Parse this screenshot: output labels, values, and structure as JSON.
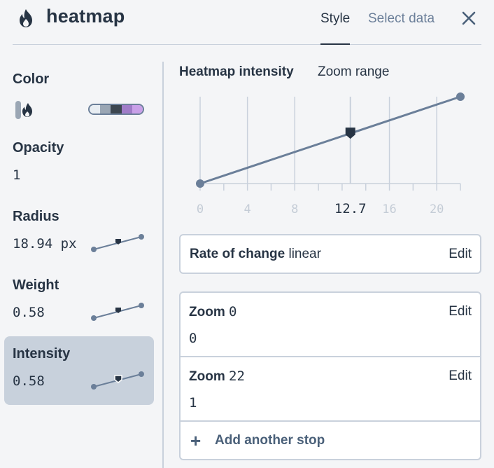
{
  "header": {
    "title": "heatmap",
    "tabs": [
      {
        "label": "Style",
        "active": true
      },
      {
        "label": "Select data",
        "active": false
      }
    ],
    "icons": {
      "app": "flame-icon",
      "close": "close-icon"
    }
  },
  "sidebar": {
    "color": {
      "label": "Color",
      "ramp": [
        "#dfe6ee",
        "#9aa6b4",
        "#4c5660",
        "#b58fd9",
        "#c9a0e8"
      ]
    },
    "opacity": {
      "label": "Opacity",
      "value": "1"
    },
    "radius": {
      "label": "Radius",
      "value": "18.94 px"
    },
    "weight": {
      "label": "Weight",
      "value": "0.58"
    },
    "intensity": {
      "label": "Intensity",
      "value": "0.58",
      "selected": true
    }
  },
  "panel": {
    "tab_active": "Heatmap intensity",
    "tab_other": "Zoom range",
    "chart_data": {
      "type": "line",
      "x_ticks": [
        "0",
        "4",
        "8",
        "12.7",
        "16",
        "20"
      ],
      "current_zoom": 12.7,
      "xlim": [
        0,
        22
      ],
      "ylim": [
        0,
        1
      ],
      "points": [
        {
          "x": 0,
          "y": 0
        },
        {
          "x": 22,
          "y": 1
        }
      ],
      "marker": {
        "x": 12.7,
        "y": 0.58
      }
    },
    "rate": {
      "label": "Rate of change",
      "value": "linear",
      "edit": "Edit"
    },
    "stops": [
      {
        "label": "Zoom",
        "zoom": "0",
        "value": "0",
        "edit": "Edit"
      },
      {
        "label": "Zoom",
        "zoom": "22",
        "value": "1",
        "edit": "Edit"
      }
    ],
    "add_stop": "Add another stop"
  }
}
